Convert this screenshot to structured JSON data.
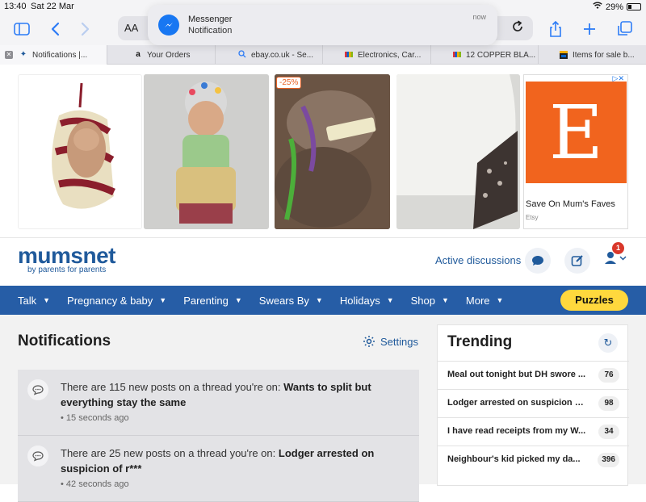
{
  "status_bar": {
    "time": "13:40",
    "date": "Sat 22 Mar",
    "battery": "29%"
  },
  "toolbar": {
    "aa_label": "AA"
  },
  "banner": {
    "app": "Messenger",
    "body": "Notification",
    "when": "now"
  },
  "tabs": [
    {
      "label": "Notifications |...",
      "icon": "mumsnet-favicon",
      "active": true
    },
    {
      "label": "Your Orders",
      "icon": "amazon-favicon"
    },
    {
      "label": "ebay.co.uk - Se...",
      "icon": "search-favicon"
    },
    {
      "label": "Electronics, Car...",
      "icon": "ebay-favicon"
    },
    {
      "label": "12 COPPER BLA...",
      "icon": "ebay-favicon"
    },
    {
      "label": "Items for sale b...",
      "icon": "shop-favicon"
    }
  ],
  "ads": {
    "discount_badge": "-25%",
    "etsy_logo": "E",
    "etsy_caption": "Save On Mum's Faves",
    "etsy_brand": "Etsy"
  },
  "header": {
    "logo": "mumsnet",
    "tagline": "by parents for parents",
    "active_discussions": "Active discussions",
    "user_badge": "1"
  },
  "nav": {
    "items": [
      "Talk",
      "Pregnancy & baby",
      "Parenting",
      "Swears By",
      "Holidays",
      "Shop",
      "More"
    ],
    "puzzles": "Puzzles"
  },
  "notifications": {
    "title": "Notifications",
    "settings": "Settings",
    "items": [
      {
        "prefix": "There are 115 new posts on a thread you're on: ",
        "thread": "Wants to split but everything stay the same",
        "ago": "• 15 seconds ago"
      },
      {
        "prefix": "There are 25 new posts on a thread you're on: ",
        "thread": "Lodger arrested on suspicion of r***",
        "ago": "• 42 seconds ago"
      }
    ]
  },
  "trending": {
    "title": "Trending",
    "items": [
      {
        "title": "Meal out tonight but DH swore ...",
        "count": "76"
      },
      {
        "title": "Lodger arrested on suspicion o...",
        "count": "98"
      },
      {
        "title": "I have read receipts from my W...",
        "count": "34"
      },
      {
        "title": "Neighbour's kid picked my da...",
        "count": "396"
      }
    ]
  },
  "colors": {
    "brand": "#205a9b",
    "nav": "#265da6",
    "puzzles": "#ffd83d",
    "etsy": "#f1641e",
    "badge": "#d9372a"
  }
}
